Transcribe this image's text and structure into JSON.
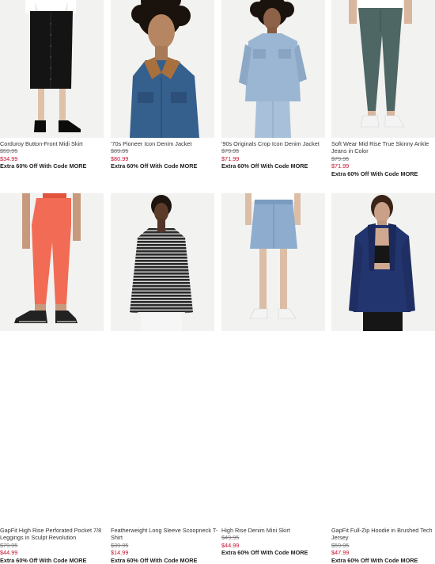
{
  "products": [
    {
      "name": "Corduroy Button-Front Midi Skirt",
      "was_price": "$59.95",
      "sale_price": "$34.99",
      "promo": "Extra 60% Off With Code MORE",
      "image": "model wearing black button-front midi skirt with black loafers"
    },
    {
      "name": "'70s Pioneer Icon Denim Jacket",
      "was_price": "$89.95",
      "sale_price": "$80.99",
      "promo": "Extra 60% Off With Code MORE",
      "image": "model with curly hair wearing denim jacket with corduroy collar"
    },
    {
      "name": "'90s Originals Crop Icon Denim Jacket",
      "was_price": "$79.95",
      "sale_price": "$71.99",
      "promo": "Extra 60% Off With Code MORE",
      "image": "model wearing light-wash cropped denim jacket and jeans"
    },
    {
      "name": "Soft Wear Mid Rise True Skinny Ankle Jeans in Color",
      "was_price": "$79.95",
      "sale_price": "$71.99",
      "promo": "Extra 60% Off With Code MORE",
      "image": "model wearing dark green skinny jeans with white sneakers"
    },
    {
      "name": "GapFit High Rise Perforated Pocket 7/8 Leggings in Sculpt Revolution",
      "was_price": "$79.95",
      "sale_price": "$44.99",
      "promo": "Extra 60% Off With Code MORE",
      "image": "model wearing coral leggings with black sneakers"
    },
    {
      "name": "Featherweight Long Sleeve Scoopneck T-Shirt",
      "was_price": "$39.95",
      "sale_price": "$14.99",
      "promo": "Extra 60% Off With Code MORE",
      "image": "model wearing black and white striped long sleeve top"
    },
    {
      "name": "High Rise Denim Mini Skirt",
      "was_price": "$49.95",
      "sale_price": "$44.99",
      "promo": "Extra 60% Off With Code MORE",
      "image": "model wearing light denim mini skirt with white sneakers"
    },
    {
      "name": "GapFit Full-Zip Hoodie in Brushed Tech Jersey",
      "was_price": "$59.95",
      "sale_price": "$47.99",
      "promo": "Extra 60% Off With Code MORE",
      "image": "model wearing navy full-zip hoodie over black sports bra"
    }
  ]
}
